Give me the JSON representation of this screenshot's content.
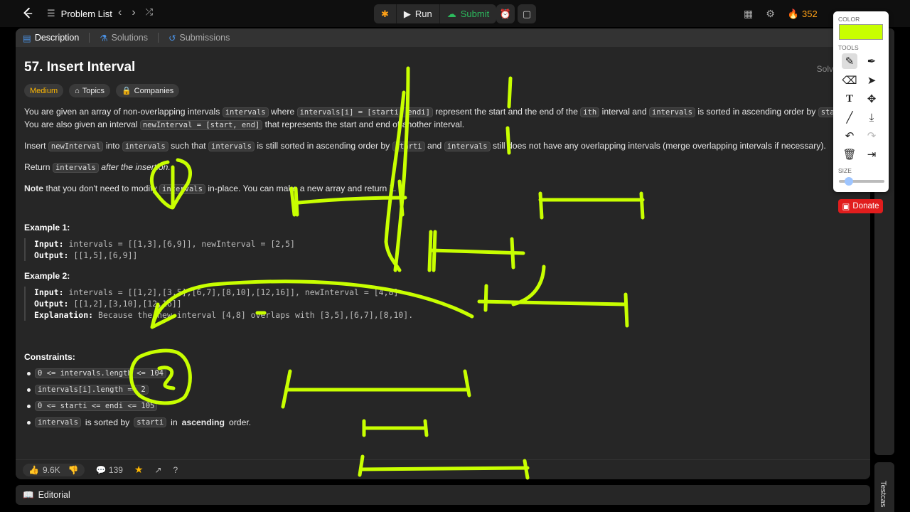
{
  "topbar": {
    "problem_list": "Problem List",
    "run": "Run",
    "submit": "Submit",
    "streak": "352"
  },
  "tabs": {
    "description": "Description",
    "solutions": "Solutions",
    "submissions": "Submissions"
  },
  "problem": {
    "title": "57. Insert Interval",
    "solved": "Solv",
    "difficulty": "Medium",
    "topics": "Topics",
    "companies": "Companies",
    "p1a": "You are given an array of non-overlapping intervals",
    "p1b": "where",
    "p1c": "represent the start and the end of the",
    "p1d": "interval and",
    "p1e": "is sorted in ascending order by",
    "p1f": ". You are also",
    "p1g": "given an interval",
    "p1h": "that represents the start and end of another interval.",
    "code_intervals": "intervals",
    "code_intervals_i": "intervals[i] = [starti, endi]",
    "code_starti": "starti",
    "code_newinterval": "newInterval = [start, end]",
    "code_newInterval": "newInterval",
    "p2a": "Insert",
    "p2b": "into",
    "p2c": "such that",
    "p2d": "is still sorted in ascending order by",
    "p2e": "and",
    "p2f": "still does not have any overlapping intervals (merge overlapping intervals if necessary).",
    "p3a": "Return",
    "p3b": "after the insertion.",
    "p4a": "Note",
    "p4b": "that you don't need to modify",
    "p4c": "in-place. You can make a new array and return it.",
    "ith": "ith"
  },
  "example1": {
    "title": "Example 1:",
    "input_label": "Input:",
    "input": "intervals = [[1,3],[6,9]], newInterval = [2,5]",
    "output_label": "Output:",
    "output": "[[1,5],[6,9]]"
  },
  "example2": {
    "title": "Example 2:",
    "input_label": "Input:",
    "input": "intervals = [[1,2],[3,5],[6,7],[8,10],[12,16]], newInterval = [4,8]",
    "output_label": "Output:",
    "output": "[[1,2],[3,10],[12,16]]",
    "explanation_label": "Explanation:",
    "explanation": "Because the new interval [4,8] overlaps with [3,5],[6,7],[8,10]."
  },
  "constraints": {
    "title": "Constraints:",
    "c1": "0 <= intervals.length <= 104",
    "c2": "intervals[i].length == 2",
    "c3": "0 <= starti <= endi <= 105",
    "c4a": "intervals",
    "c4b": "is sorted by",
    "c4c": "starti",
    "c4d": "in",
    "c4e": "ascending",
    "c4f": "order."
  },
  "footer": {
    "likes": "9.6K",
    "comments": "139"
  },
  "editorial": "Editorial",
  "testcase": "Testcas",
  "palette": {
    "color_label": "COLOR",
    "tools_label": "TOOLS",
    "size_label": "SIZE",
    "color": "#c8ff00",
    "size_level": 0.15
  },
  "donate": "Donate"
}
